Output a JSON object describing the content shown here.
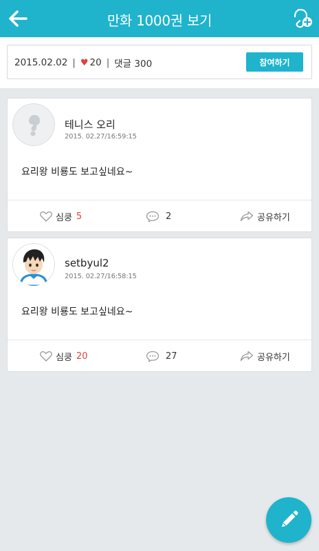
{
  "appbar": {
    "title": "만화 1000권 보기",
    "back_icon": "arrow-left-icon",
    "action_icon": "add-friend-icon"
  },
  "info": {
    "date": "2015.02.02",
    "separator": "|",
    "likes": "20",
    "comments_label": "댓글 300",
    "join_label": "참여하기"
  },
  "posts": [
    {
      "author": "테니스 오리",
      "time": "2015. 02.27/16:59:15",
      "content": "요리왕 비룡도 보고싶네요~",
      "like_label": "심쿵",
      "like_count": "5",
      "comment_count": "2",
      "share_label": "공유하기"
    },
    {
      "author": "setbyul2",
      "time": "2015. 02.27/16:58:15",
      "content": "요리왕 비룡도 보고싶네요~",
      "like_label": "심쿵",
      "like_count": "20",
      "comment_count": "27",
      "share_label": "공유하기"
    }
  ],
  "fab": {
    "icon": "pencil-icon"
  },
  "colors": {
    "accent": "#1fb3cc",
    "heart": "#e0413b",
    "background": "#e6e9ec"
  }
}
